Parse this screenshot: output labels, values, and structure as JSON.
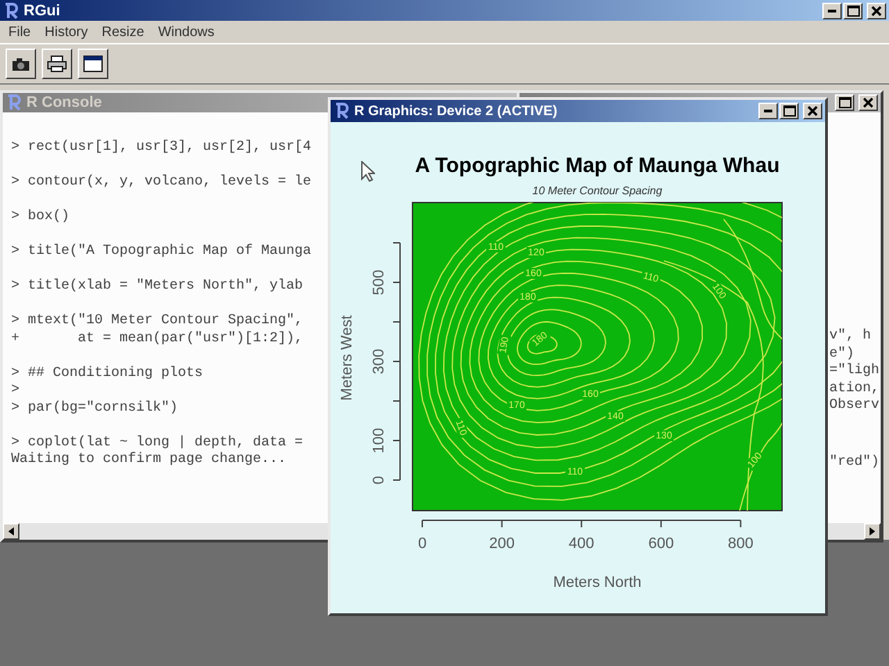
{
  "app": {
    "title": "RGui",
    "menu": [
      "File",
      "History",
      "Resize",
      "Windows"
    ]
  },
  "console": {
    "title": "R Console",
    "active": false,
    "blocks": [
      [
        "> rect(usr[1], usr[3], usr[2], usr[4"
      ],
      [
        "> contour(x, y, volcano, levels = le"
      ],
      [
        "> box()"
      ],
      [
        "> title(\"A Topographic Map of Maunga"
      ],
      [
        "> title(xlab = \"Meters North\", ylab"
      ],
      [
        "> mtext(\"10 Meter Contour Spacing\",",
        "+       at = mean(par(\"usr\")[1:2]),"
      ],
      [
        "> ## Conditioning plots",
        ">",
        "> par(bg=\"cornsilk\")"
      ],
      [
        "> coplot(lat ~ long | depth, data =",
        "Waiting to confirm page change..."
      ]
    ]
  },
  "back_window": {
    "active": false,
    "blocks": [
      [
        "v\", h",
        "e\")",
        "=\"ligh",
        "ation,",
        "Observ"
      ],
      [
        "\"red\")"
      ]
    ]
  },
  "graphics": {
    "title": "R Graphics: Device 2 (ACTIVE)",
    "active": true,
    "plot": {
      "title": "A Topographic Map of Maunga Whau",
      "subtitle": "10 Meter Contour Spacing",
      "xlabel": "Meters North",
      "ylabel": "Meters West",
      "xticks": [
        "0",
        "200",
        "400",
        "600",
        "800"
      ],
      "yticks": [
        "0",
        "100",
        "300",
        "500"
      ],
      "contour_labels": [
        "110",
        "120",
        "160",
        "180",
        "190",
        "180",
        "160",
        "170",
        "140",
        "130",
        "110",
        "110",
        "100",
        "110",
        "100"
      ]
    }
  }
}
